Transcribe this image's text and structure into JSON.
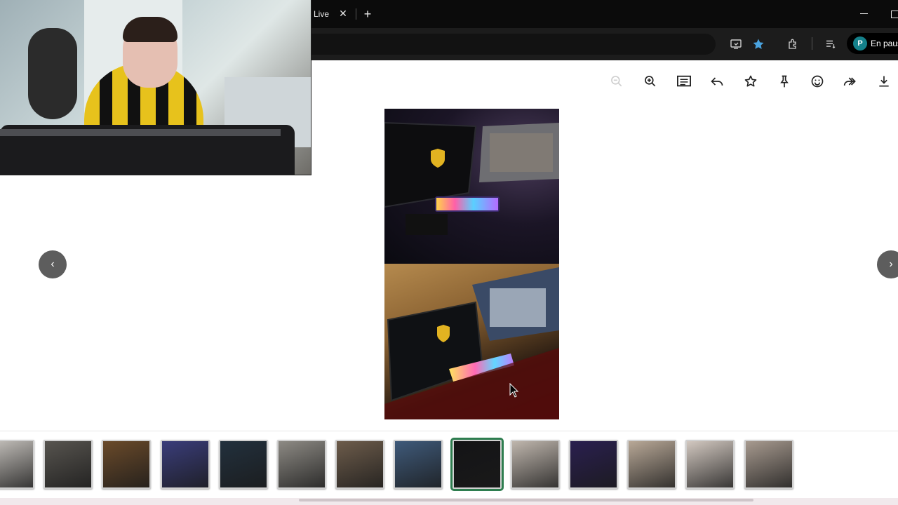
{
  "browser": {
    "tab_title": "Live",
    "tab_close": "✕",
    "new_tab": "+",
    "profile": {
      "initial": "P",
      "label": "En pausa"
    }
  },
  "toolbar_icons": [
    "cast-icon",
    "bookmark-star-icon",
    "extensions-icon",
    "reading-list-icon"
  ],
  "viewer": {
    "toolbar": [
      "zoom-out",
      "zoom-in",
      "caption",
      "reply",
      "favorite",
      "pin",
      "react",
      "forward",
      "download"
    ],
    "prev_label": "‹",
    "next_label": "›"
  },
  "thumbnails": {
    "count": 14,
    "selected_index": 8,
    "colors": [
      "#c7c3be",
      "#57544f",
      "#6a4a2a",
      "#3a3d7a",
      "#22303d",
      "#8d8a84",
      "#6d5c4b",
      "#3f5a7a",
      "#141416",
      "#bfb6ad",
      "#2a1f4f",
      "#b8a897",
      "#d2c8c0",
      "#a79a8f"
    ]
  },
  "colors": {
    "tabbar": "#0b0b0b",
    "accent_star": "#4aa3df",
    "selected_border": "#2e7d4f",
    "profile_avatar": "#14808a"
  }
}
